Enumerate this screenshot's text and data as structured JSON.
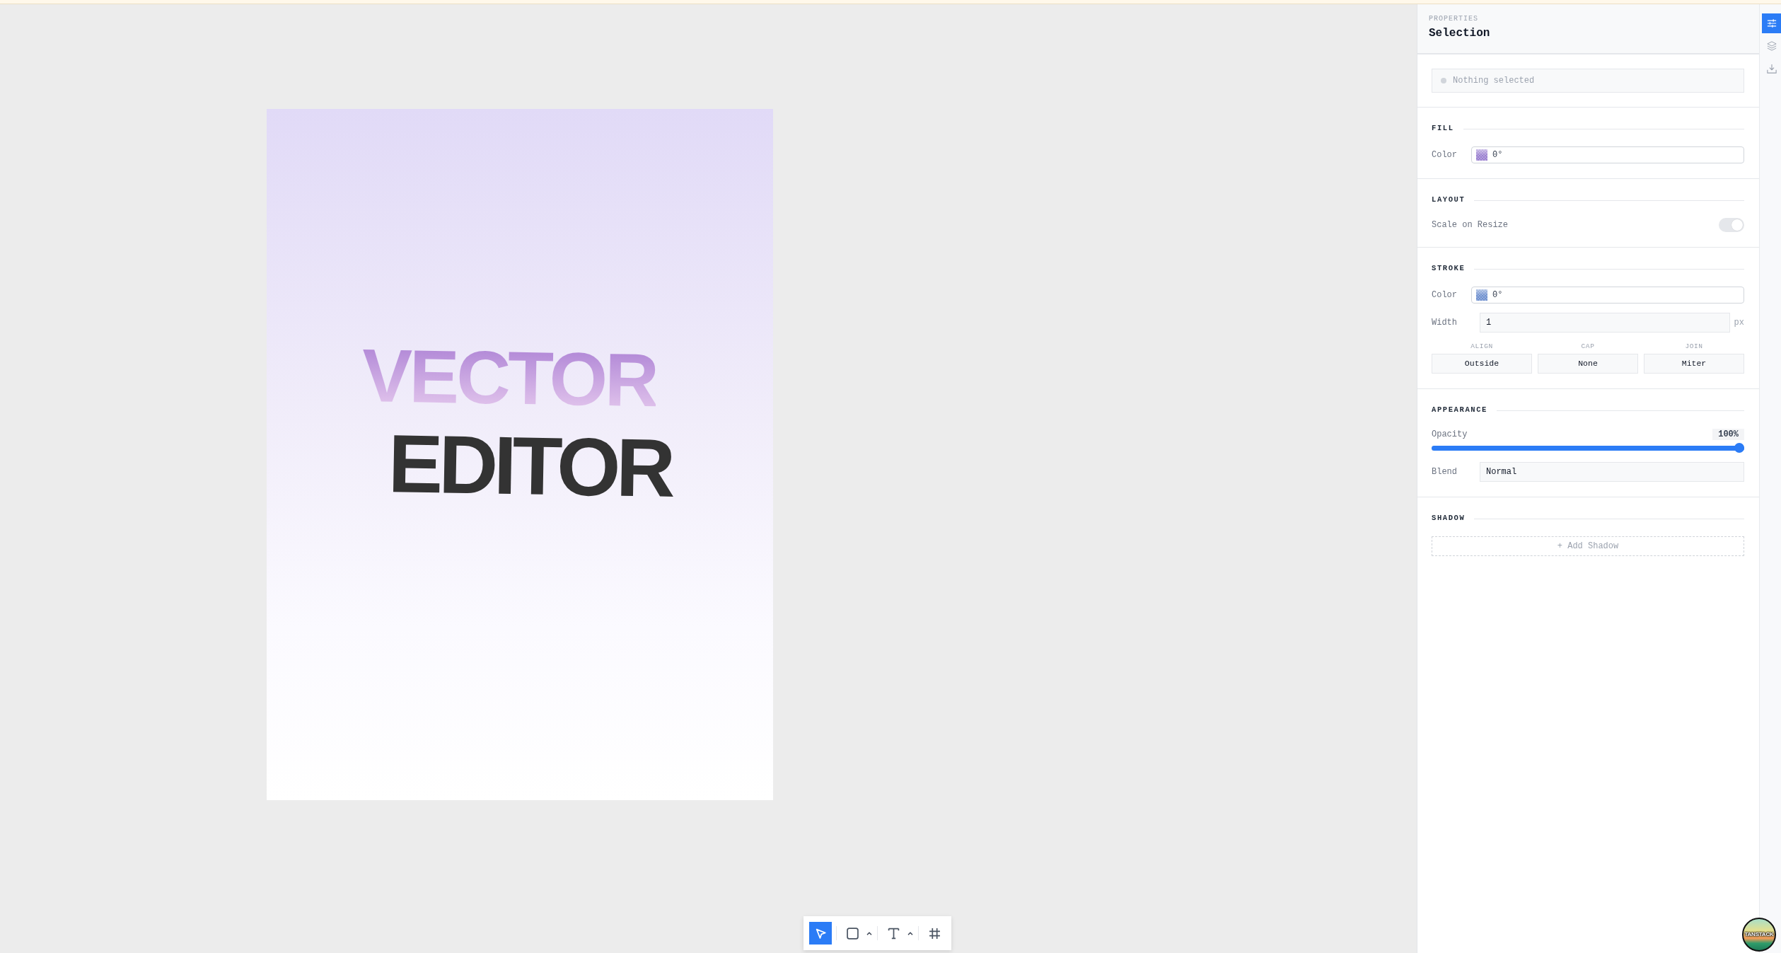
{
  "artboard": {
    "lines": [
      {
        "text": "VECTOR",
        "kind": "gradient"
      },
      {
        "text": "EDITOR",
        "kind": "solid"
      }
    ]
  },
  "toolbar": {
    "tools": [
      {
        "kind": "select",
        "selected": true,
        "menu": false
      },
      {
        "kind": "rectangle",
        "selected": false,
        "menu": true
      },
      {
        "kind": "text",
        "selected": false,
        "menu": true
      },
      {
        "kind": "frame",
        "selected": false,
        "menu": false
      }
    ]
  },
  "properties_panel": {
    "eyebrow": "PROPERTIES",
    "title": "Selection",
    "status": "Nothing selected",
    "sections": [
      {
        "heading": "FILL",
        "rows": [
          {
            "kind": "color",
            "label": "Color",
            "value": "0°",
            "color": "#9a80d0"
          }
        ]
      },
      {
        "heading": "LAYOUT",
        "rows": [
          {
            "kind": "toggle",
            "label": "Scale on Resize",
            "on": true,
            "disabled": true
          }
        ]
      },
      {
        "heading": "STROKE",
        "rows": [
          {
            "kind": "color",
            "label": "Color",
            "value": "0°",
            "color": "#6f90cf"
          },
          {
            "kind": "number",
            "label": "Width",
            "value": "1",
            "unit": "px"
          },
          {
            "kind": "options",
            "options": [
              {
                "label": "ALIGN",
                "value": "Outside"
              },
              {
                "label": "CAP",
                "value": "None"
              },
              {
                "label": "JOIN",
                "value": "Miter"
              }
            ]
          }
        ]
      },
      {
        "heading": "APPEARANCE",
        "rows": [
          {
            "kind": "slider",
            "label": "Opacity",
            "reading": "100%",
            "level": 1
          },
          {
            "kind": "select",
            "label": "Blend",
            "value": "Normal"
          }
        ]
      },
      {
        "heading": "SHADOW",
        "rows": [
          {
            "kind": "add_button",
            "label": "+ Add Shadow"
          }
        ]
      }
    ]
  },
  "side_rail": {
    "tabs": [
      {
        "kind": "properties",
        "selected": true
      },
      {
        "kind": "layers",
        "selected": false
      },
      {
        "kind": "export",
        "selected": false
      }
    ]
  },
  "corner_badge": {
    "label": "TANSTACK"
  }
}
